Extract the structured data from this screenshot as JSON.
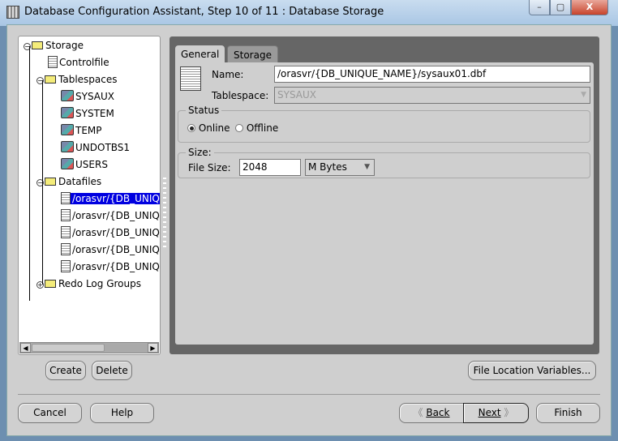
{
  "window": {
    "title": "Database Configuration Assistant, Step 10 of 11 : Database Storage",
    "minimize": "–",
    "maximize": "▢",
    "close": "X"
  },
  "tree": [
    {
      "label": "Storage",
      "icon": "folder",
      "level": 0,
      "expander": "minus"
    },
    {
      "label": "Controlfile",
      "icon": "controlfile",
      "level": 1
    },
    {
      "label": "Tablespaces",
      "icon": "folder",
      "level": 1,
      "expander": "minus"
    },
    {
      "label": "SYSAUX",
      "icon": "tablespace",
      "level": 2
    },
    {
      "label": "SYSTEM",
      "icon": "tablespace",
      "level": 2
    },
    {
      "label": "TEMP",
      "icon": "tablespace",
      "level": 2
    },
    {
      "label": "UNDOTBS1",
      "icon": "tablespace",
      "level": 2
    },
    {
      "label": "USERS",
      "icon": "tablespace",
      "level": 2
    },
    {
      "label": "Datafiles",
      "icon": "folder",
      "level": 1,
      "expander": "minus"
    },
    {
      "label": "/orasvr/{DB_UNIQ",
      "icon": "datafile",
      "level": 2,
      "selected": true
    },
    {
      "label": "/orasvr/{DB_UNIQ",
      "icon": "datafile",
      "level": 2
    },
    {
      "label": "/orasvr/{DB_UNIQ",
      "icon": "datafile",
      "level": 2
    },
    {
      "label": "/orasvr/{DB_UNIQ",
      "icon": "datafile",
      "level": 2
    },
    {
      "label": "/orasvr/{DB_UNIQ",
      "icon": "datafile",
      "level": 2
    },
    {
      "label": "Redo Log Groups",
      "icon": "folder",
      "level": 1,
      "expander": "plus"
    }
  ],
  "tabs": {
    "general": "General",
    "storage": "Storage"
  },
  "general": {
    "name_label": "Name:",
    "name_value": "/orasvr/{DB_UNIQUE_NAME}/sysaux01.dbf",
    "tablespace_label": "Tablespace:",
    "tablespace_value": "SYSAUX",
    "status_title": "Status",
    "online": "Online",
    "offline": "Offline",
    "status_selected": "Online",
    "size_title": "Size:",
    "file_size_label": "File Size:",
    "file_size_value": "2048",
    "unit": "M Bytes"
  },
  "buttons": {
    "create": "Create",
    "delete": "Delete",
    "file_location_variables": "File Location Variables...",
    "cancel": "Cancel",
    "help": "Help",
    "back": "Back",
    "next": "Next",
    "finish": "Finish"
  },
  "colors": {
    "selection": "#0000e0",
    "main_panel": "#666666",
    "background": "#cfcfcf"
  }
}
